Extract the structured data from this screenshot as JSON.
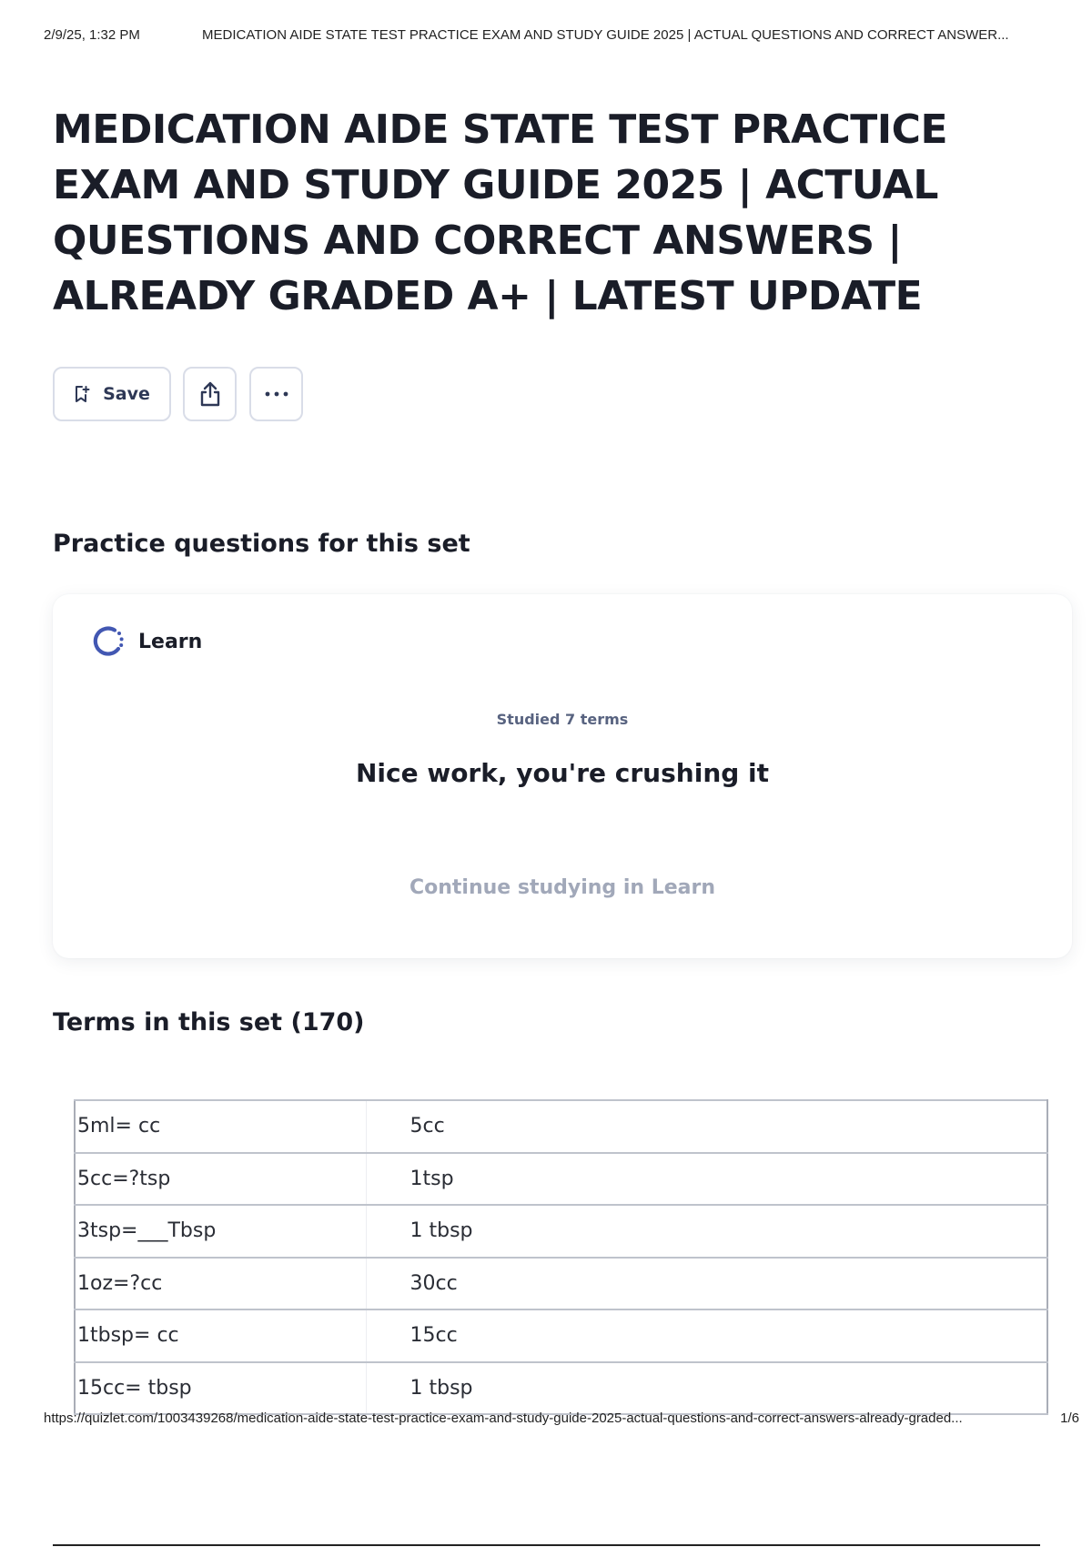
{
  "print_header": {
    "date": "2/9/25, 1:32 PM",
    "doc_title": "MEDICATION AIDE STATE TEST PRACTICE EXAM AND STUDY GUIDE 2025 | ACTUAL QUESTIONS AND CORRECT ANSWER..."
  },
  "page": {
    "title": "MEDICATION AIDE STATE TEST PRACTICE EXAM AND STUDY GUIDE 2025 | ACTUAL QUESTIONS AND CORRECT ANSWERS | ALREADY GRADED A+ | LATEST UPDATE"
  },
  "actions": {
    "save_label": "Save",
    "save_icon": "bookmark-plus-icon",
    "share_icon": "share-icon",
    "more_icon": "more-horizontal-icon"
  },
  "practice": {
    "heading": "Practice questions for this set",
    "card": {
      "mode_label": "Learn",
      "mode_icon": "learn-progress-icon",
      "studied_text": "Studied 7 terms",
      "praise_text": "Nice work, you're crushing it",
      "continue_label": "Continue studying in Learn"
    }
  },
  "terms": {
    "heading": "Terms in this set (170)",
    "rows": [
      {
        "term": "5ml= cc",
        "definition": "5cc"
      },
      {
        "term": "5cc=?tsp",
        "definition": "1tsp"
      },
      {
        "term": "3tsp=___Tbsp",
        "definition": "1 tbsp"
      },
      {
        "term": "1oz=?cc",
        "definition": "30cc"
      },
      {
        "term": "1tbsp= cc",
        "definition": "15cc"
      },
      {
        "term": "15cc= tbsp",
        "definition": "1 tbsp"
      }
    ]
  },
  "print_footer": {
    "url": "https://quizlet.com/1003439268/medication-aide-state-test-practice-exam-and-study-guide-2025-actual-questions-and-correct-answers-already-graded...",
    "page_number": "1/6"
  },
  "colors": {
    "text": "#1a1d28",
    "muted": "#586380",
    "link_muted": "#a1a8b9",
    "accent": "#4257b2",
    "border": "#d9dde8"
  }
}
